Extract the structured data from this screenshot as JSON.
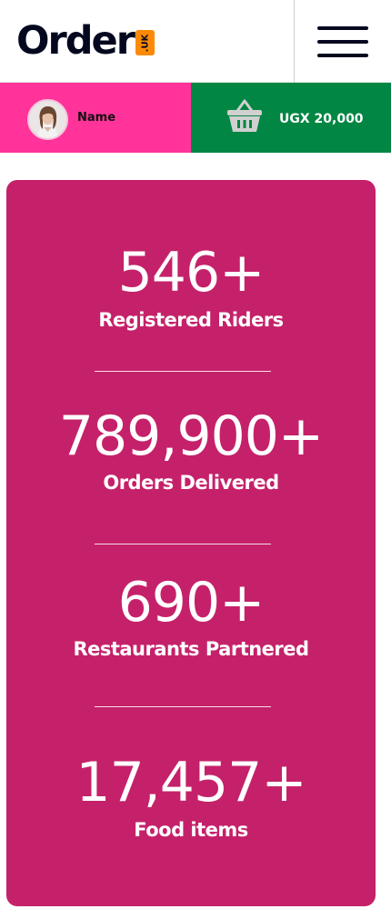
{
  "brand": {
    "name": "Order",
    "badge": ".UK",
    "badge_color": "#fc8a06",
    "text_color": "#03081f"
  },
  "header": {
    "menu_icon": "hamburger-menu-icon"
  },
  "user": {
    "name": "Name",
    "avatar_icon": "user-avatar",
    "bar_color": "#ff3399"
  },
  "basket": {
    "icon": "shopping-basket-icon",
    "amount": "UGX 20,000",
    "bar_color": "#028643"
  },
  "stats": {
    "card_color": "#c5216a",
    "items": [
      {
        "number": "546+",
        "label": "Registered Riders"
      },
      {
        "number": "789,900+",
        "label": "Orders Delivered"
      },
      {
        "number": "690+",
        "label": "Restaurants Partnered"
      },
      {
        "number": "17,457+",
        "label": "Food items"
      }
    ]
  }
}
